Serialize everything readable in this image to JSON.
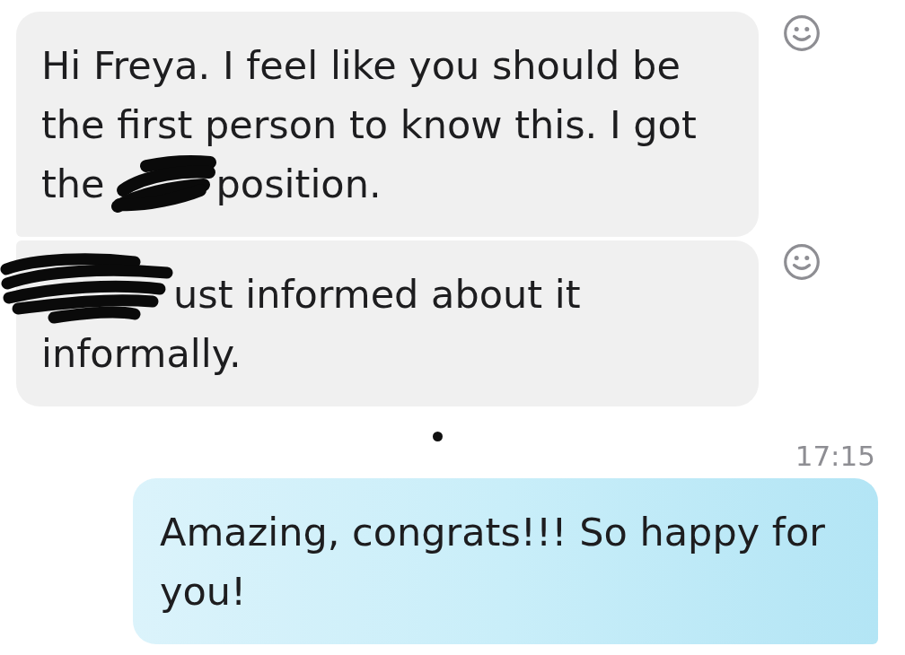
{
  "thread": [
    {
      "kind": "received",
      "rows": [
        [
          {
            "kind": "text",
            "text": "Hi Freya. I feel like you should be the first person to know this. I got"
          }
        ],
        [
          {
            "kind": "text",
            "text": "the"
          },
          {
            "kind": "redacted"
          },
          {
            "kind": "text",
            "text": "position."
          }
        ]
      ]
    },
    {
      "kind": "received",
      "rows": [
        [
          {
            "kind": "redacted"
          },
          {
            "kind": "text",
            "text": "ust informed about it"
          }
        ],
        [
          {
            "kind": "text",
            "text": "informally."
          }
        ]
      ]
    },
    {
      "kind": "time",
      "text": "17:15"
    },
    {
      "kind": "sent",
      "rows": [
        [
          {
            "kind": "text",
            "text": "Amazing, congrats!!! So happy for you!"
          }
        ]
      ]
    }
  ]
}
